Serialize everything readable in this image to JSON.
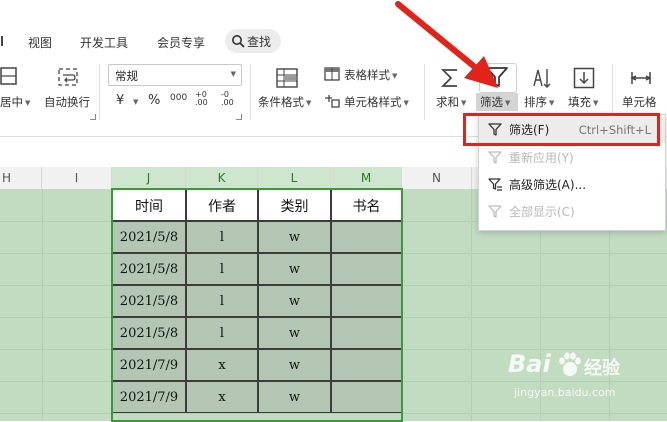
{
  "menu": {
    "tabs": [
      "视图",
      "开发工具",
      "会员专享",
      "查找"
    ],
    "search_label": "查找"
  },
  "ribbon": {
    "merge_label": "居中",
    "wrap_label": "自动换行",
    "number_format": "常规",
    "currency_symbol": "¥",
    "percent_symbol": "%",
    "thousands_symbol": "000",
    "decimal_increase": [
      "+0",
      ".00"
    ],
    "decimal_decrease": [
      "-0",
      ".00"
    ],
    "conditional_format": "条件格式",
    "table_style": "表格样式",
    "cell_style": "单元格样式",
    "sum_label": "求和",
    "filter_label": "筛选",
    "sort_label": "排序",
    "fill_label": "填充",
    "cell_label": "单元格"
  },
  "columns": [
    "H",
    "I",
    "J",
    "K",
    "L",
    "M",
    "N"
  ],
  "table": {
    "headers": [
      "时间",
      "作者",
      "类别",
      "书名"
    ],
    "rows": [
      [
        "2021/5/8",
        "l",
        "w",
        ""
      ],
      [
        "2021/5/8",
        "l",
        "w",
        ""
      ],
      [
        "2021/5/8",
        "l",
        "w",
        ""
      ],
      [
        "2021/5/8",
        "l",
        "w",
        ""
      ],
      [
        "2021/7/9",
        "x",
        "w",
        ""
      ],
      [
        "2021/7/9",
        "x",
        "w",
        ""
      ]
    ]
  },
  "dropdown": {
    "items": [
      {
        "label": "筛选(F)",
        "shortcut": "Ctrl+Shift+L",
        "enabled": true
      },
      {
        "label": "重新应用(Y)",
        "shortcut": "",
        "enabled": false
      },
      {
        "label": "高级筛选(A)...",
        "shortcut": "",
        "enabled": true
      },
      {
        "label": "全部显示(C)",
        "shortcut": "",
        "enabled": false
      }
    ]
  },
  "watermark": {
    "brand": "Bai",
    "brand2": "经验",
    "url": "jingyan.baidu.com"
  },
  "colors": {
    "arrow": "#e2231a",
    "selection": "#3a9a3a",
    "cell_fill": "#b3c6b3",
    "sheet_fill": "#c2dcc2"
  }
}
